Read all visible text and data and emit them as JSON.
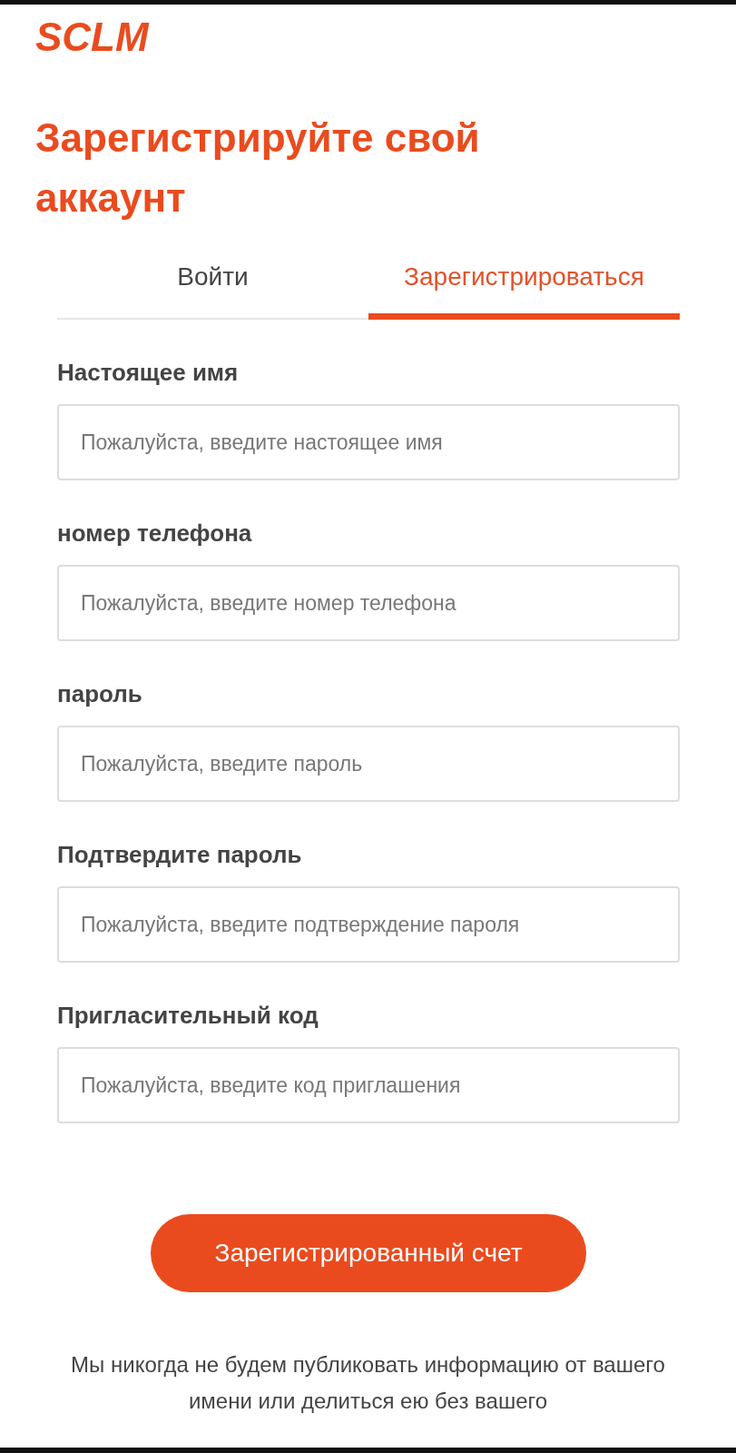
{
  "logo": "SCLM",
  "title": "Зарегистрируйте свой аккаунт",
  "tabs": [
    {
      "label": "Войти",
      "selected": false
    },
    {
      "label": "Зарегистрироваться",
      "selected": true
    }
  ],
  "fields": [
    {
      "label": "Настоящее имя",
      "placeholder": "Пожалуйста, введите настоящее имя"
    },
    {
      "label": "номер телефона",
      "placeholder": "Пожалуйста, введите номер телефона"
    },
    {
      "label": "пароль",
      "placeholder": "Пожалуйста, введите пароль"
    },
    {
      "label": "Подтвердите пароль",
      "placeholder": "Пожалуйста, введите подтверждение пароля"
    },
    {
      "label": "Пригласительный код",
      "placeholder": "Пожалуйста, введите код приглашения"
    }
  ],
  "submit": "Зарегистрированный счет",
  "notice": "Мы никогда не будем публиковать информацию от вашего имени или делиться ею без вашего"
}
